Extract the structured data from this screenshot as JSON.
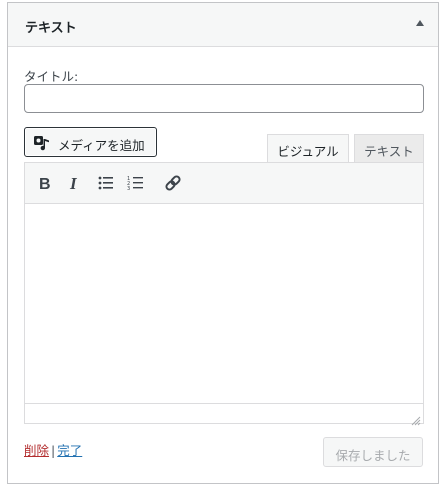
{
  "widget": {
    "title": "テキスト",
    "toggle_icon": "arrow-up-icon"
  },
  "form": {
    "title_label": "タイトル:",
    "title_value": "",
    "title_placeholder": ""
  },
  "editor": {
    "add_media_label": "メディアを追加",
    "tabs": [
      {
        "label": "ビジュアル",
        "active": true
      },
      {
        "label": "テキスト",
        "active": false
      }
    ],
    "toolbar": [
      {
        "name": "bold-icon"
      },
      {
        "name": "italic-icon"
      },
      {
        "name": "bulleted-list-icon"
      },
      {
        "name": "numbered-list-icon"
      },
      {
        "name": "link-icon"
      }
    ],
    "content": ""
  },
  "footer": {
    "delete_label": "削除",
    "separator": "|",
    "done_label": "完了",
    "save_label": "保存しました"
  },
  "colors": {
    "link": "#2271b1",
    "delete": "#b32d2e",
    "disabled_text": "#a7aaad"
  }
}
